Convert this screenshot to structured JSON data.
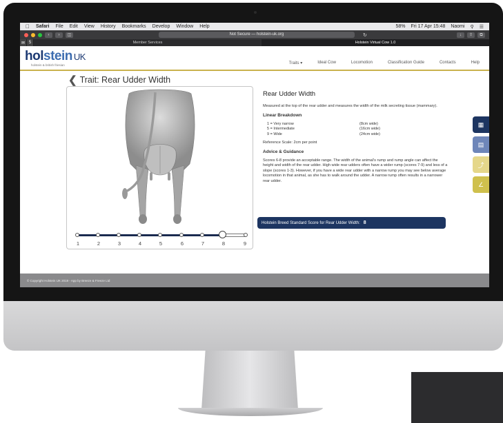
{
  "menubar": {
    "items": [
      "Safari",
      "File",
      "Edit",
      "View",
      "History",
      "Bookmarks",
      "Develop",
      "Window",
      "Help"
    ],
    "status": [
      "58%",
      "Fri 17 Apr 15:48",
      "Naomi"
    ]
  },
  "browser": {
    "address": "Not Secure — holstein-uk.org",
    "tabs": [
      "Member Services",
      "Holstein Virtual Cow 1.0"
    ],
    "tab_icon_label": "5"
  },
  "site": {
    "logo_prefix": "hol",
    "logo_accent": "stein",
    "logo_suffix": "UK",
    "logo_tagline": "holstein & british friesian",
    "nav": [
      "Traits ▾",
      "Ideal Cow",
      "Locomotion",
      "Classification Guide",
      "Contacts",
      "Help"
    ]
  },
  "trait": {
    "heading": "Trait: Rear Udder Width",
    "title": "Rear Udder Width",
    "description": "Measured at the top of the rear udder and measures the width of the milk secreting tissue (mammary).",
    "linear_heading": "Linear Breakdown",
    "linear": [
      {
        "label": "1 = Very narrow",
        "value": "(8cm wide)"
      },
      {
        "label": "5 = Intermediate",
        "value": "(16cm wide)"
      },
      {
        "label": "9 = Wide",
        "value": "(24cm wide)"
      }
    ],
    "reference": "Reference Scale: 2cm per point",
    "advice_heading": "Advice & Guidance",
    "advice": "Scores 6-8 provide an acceptable range. The width of the animal's rump and rump angle can affect the height and width of the rear udder. High wide rear udders often have a wider rump (scores 7-9) and less of a slope (scores 1-3). However, if you have a wide rear udder with a narrow rump you may see below average locomotion in that animal, as she has to walk around the udder. A narrow rump often results in a narrower rear udder.",
    "score_label": "Holstein Breed Standard Score for Rear Udder Width:",
    "score_value": "8"
  },
  "slider": {
    "labels": [
      "1",
      "2",
      "3",
      "4",
      "5",
      "6",
      "7",
      "8",
      "9"
    ],
    "selected": 8,
    "min": 1,
    "max": 9
  },
  "footer": {
    "text": "© Copyright Holstein UK 2019 - App by Breeze & Freeze Ltd"
  },
  "colors": {
    "navy": "#1d3561",
    "gold": "#c9b24d"
  }
}
